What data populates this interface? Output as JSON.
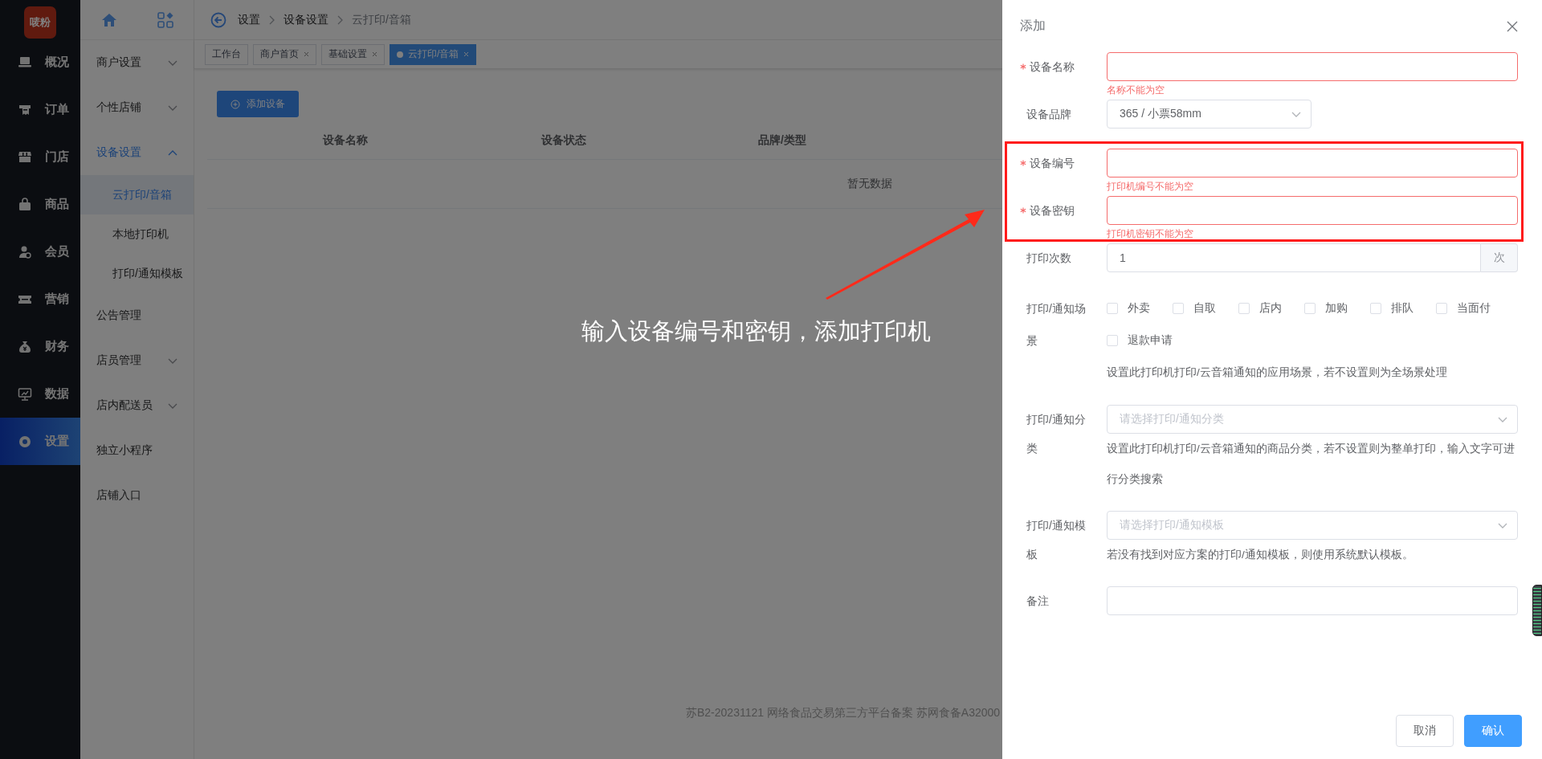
{
  "logo": {
    "text": "唛粉"
  },
  "main_nav": [
    {
      "label": "概况",
      "selected": false
    },
    {
      "label": "订单",
      "selected": false
    },
    {
      "label": "门店",
      "selected": false
    },
    {
      "label": "商品",
      "selected": false
    },
    {
      "label": "会员",
      "selected": false
    },
    {
      "label": "营销",
      "selected": false
    },
    {
      "label": "财务",
      "selected": false
    },
    {
      "label": "数据",
      "selected": false
    },
    {
      "label": "设置",
      "selected": true
    }
  ],
  "sub_nav": [
    {
      "kind": "group",
      "label": "商户设置",
      "expanded": false
    },
    {
      "kind": "group",
      "label": "个性店铺",
      "expanded": false
    },
    {
      "kind": "group",
      "label": "设备设置",
      "expanded": true,
      "children": [
        {
          "label": "云打印/音箱",
          "selected": true
        },
        {
          "label": "本地打印机",
          "selected": false
        },
        {
          "label": "打印/通知模板",
          "selected": false
        }
      ]
    },
    {
      "kind": "link",
      "label": "公告管理"
    },
    {
      "kind": "group",
      "label": "店员管理",
      "expanded": false
    },
    {
      "kind": "group",
      "label": "店内配送员",
      "expanded": false
    },
    {
      "kind": "link",
      "label": "独立小程序"
    },
    {
      "kind": "link",
      "label": "店铺入口"
    }
  ],
  "breadcrumb": [
    "设置",
    "设备设置",
    "云打印/音箱"
  ],
  "tabs": [
    {
      "label": "工作台",
      "closable": false,
      "selected": false
    },
    {
      "label": "商户首页",
      "closable": true,
      "selected": false
    },
    {
      "label": "基础设置",
      "closable": true,
      "selected": false
    },
    {
      "label": "云打印/音箱",
      "closable": true,
      "selected": true
    }
  ],
  "add_button": "添加设备",
  "table": {
    "columns": [
      "设备名称",
      "设备状态",
      "品牌/类型"
    ],
    "empty_text": "暂无数据"
  },
  "footer": "苏B2-20231121  网络食品交易第三方平台备案 苏网食备A32000",
  "drawer": {
    "title": "添加",
    "fields": [
      {
        "kind": "input",
        "label": "设备名称",
        "required": true,
        "error": "名称不能为空"
      },
      {
        "kind": "select",
        "label": "设备品牌",
        "required": false,
        "value": "365 / 小票58mm"
      },
      {
        "kind": "input",
        "label": "设备编号",
        "required": true,
        "error": "打印机编号不能为空"
      },
      {
        "kind": "input",
        "label": "设备密钥",
        "required": true,
        "error": "打印机密钥不能为空"
      },
      {
        "kind": "suffix_input",
        "label": "打印次数",
        "required": false,
        "value": "1",
        "suffix": "次"
      },
      {
        "kind": "checkboxes",
        "label": "打印/通知场景",
        "required": false,
        "options": [
          {
            "label": "外卖",
            "checked": false
          },
          {
            "label": "自取",
            "checked": false
          },
          {
            "label": "店内",
            "checked": false
          },
          {
            "label": "加购",
            "checked": false
          },
          {
            "label": "排队",
            "checked": false
          },
          {
            "label": "当面付",
            "checked": false
          },
          {
            "label": "退款申请",
            "checked": false
          }
        ],
        "hint": "设置此打印机打印/云音箱通知的应用场景，若不设置则为全场景处理"
      },
      {
        "kind": "select",
        "label": "打印/通知分类",
        "required": false,
        "placeholder": "请选择打印/通知分类",
        "hint": "设置此打印机打印/云音箱通知的商品分类，若不设置则为整单打印，输入文字可进行分类搜索"
      },
      {
        "kind": "select",
        "label": "打印/通知模板",
        "required": false,
        "placeholder": "请选择打印/通知模板",
        "hint": "若没有找到对应方案的打印/通知模板，则使用系统默认模板。"
      },
      {
        "kind": "input",
        "label": "备注",
        "required": false
      }
    ],
    "buttons": [
      {
        "kind": "secondary",
        "label": "取消"
      },
      {
        "kind": "primary",
        "label": "确认"
      }
    ]
  },
  "annotation": {
    "text": "输入设备编号和密钥，添加打印机"
  }
}
